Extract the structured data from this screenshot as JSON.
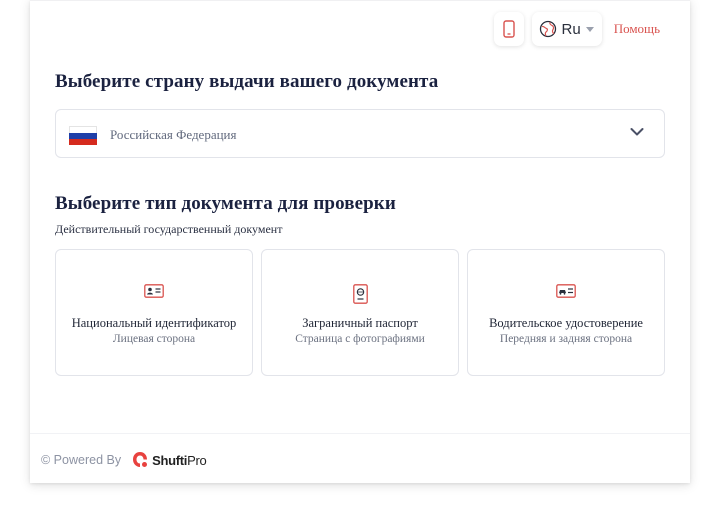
{
  "topbar": {
    "language_label": "Ru",
    "help_label": "Помощь"
  },
  "country_section": {
    "title": "Выберите страну выдачи вашего документа",
    "selected_country": "Российская Федерация"
  },
  "document_section": {
    "title": "Выберите тип документа для проверки",
    "subtitle": "Действительный государственный документ",
    "options": [
      {
        "title": "Национальный идентификатор",
        "subtitle": "Лицевая сторона",
        "icon": "id-card-icon"
      },
      {
        "title": "Заграничный паспорт",
        "subtitle": "Страница с фотографиями",
        "icon": "passport-icon"
      },
      {
        "title": "Водительское удостоверение",
        "subtitle": "Передняя и задняя сторона",
        "icon": "driving-license-icon"
      }
    ]
  },
  "footer": {
    "powered_by": "© Powered By",
    "brand_bold": "Shufti",
    "brand_light": "Pro"
  },
  "colors": {
    "accent": "#d9534f",
    "title": "#1b2240",
    "border": "#e2e4ea"
  }
}
